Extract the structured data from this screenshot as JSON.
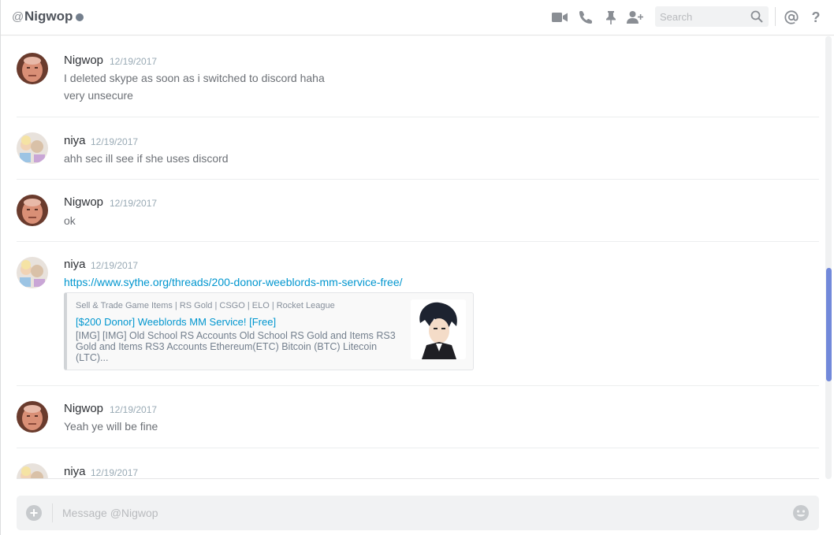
{
  "header": {
    "at_symbol": "@",
    "title": "Nigwop",
    "status_color": "#747f8d",
    "icons": [
      "video-call-icon",
      "voice-call-icon",
      "pin-icon",
      "add-friend-icon",
      "mention-icon",
      "help-icon"
    ],
    "search_placeholder": "Search",
    "help_label": "?"
  },
  "messages": [
    {
      "author": "Nigwop",
      "timestamp": "12/19/2017",
      "lines": [
        "I deleted skype as soon as i switched to discord haha",
        "very unsecure"
      ]
    },
    {
      "author": "niya",
      "timestamp": "12/19/2017",
      "lines": [
        "ahh sec ill see if she uses discord"
      ]
    },
    {
      "author": "Nigwop",
      "timestamp": "12/19/2017",
      "lines": [
        "ok"
      ]
    },
    {
      "author": "niya",
      "timestamp": "12/19/2017",
      "link": "https://www.sythe.org/threads/200-donor-weeblords-mm-service-free/",
      "embed": {
        "provider": "Sell & Trade Game Items | RS Gold | CSGO | ELO | Rocket League",
        "title": "[$200 Donor] Weeblords MM Service! [Free]",
        "description": "[IMG] [IMG] Old School RS Accounts Old School RS Gold and Items RS3 Gold and Items RS3 Accounts Ethereum(ETC) Bitcoin (BTC) Litecoin (LTC)..."
      }
    },
    {
      "author": "Nigwop",
      "timestamp": "12/19/2017",
      "lines": [
        "Yeah ye will be fine"
      ]
    },
    {
      "author": "niya",
      "timestamp": "12/19/2017",
      "lines": []
    }
  ],
  "composer": {
    "placeholder": "Message @Nigwop",
    "upload_label": "+"
  },
  "colors": {
    "accent": "#7289da",
    "link": "#0096cf",
    "timestamp": "#99aab5"
  }
}
